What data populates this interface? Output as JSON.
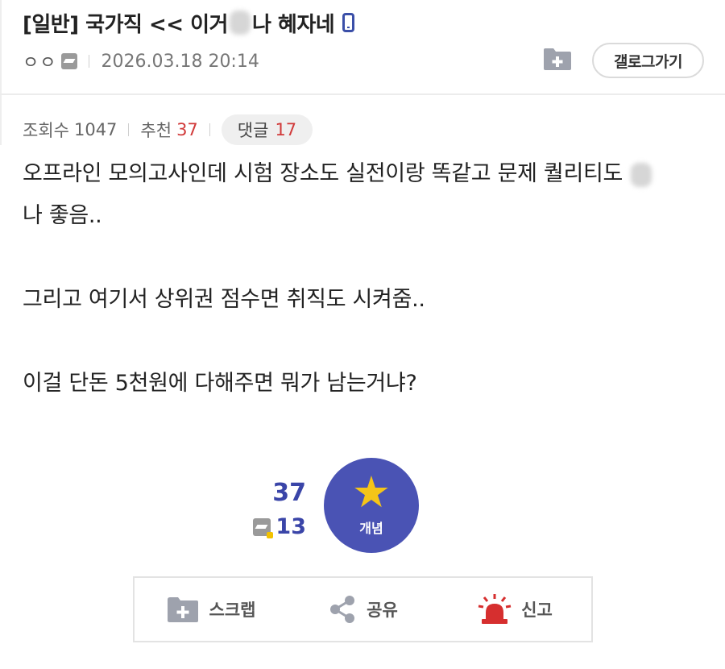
{
  "post": {
    "title_prefix": "[일반] 국가직 << 이거",
    "title_suffix": "나 혜자네",
    "author": "ㅇㅇ",
    "date": "2026.03.18 20:14",
    "gallery_button": "갤로그가기"
  },
  "stats": {
    "views_label": "조회수",
    "views": "1047",
    "recommend_label": "추천",
    "recommend": "37",
    "comments_label": "댓글",
    "comments": "17"
  },
  "content": {
    "line1": "오프라인 모의고사인데 시험 장소도 실전이랑 똑같고 문제 퀄리티도",
    "line2": "나 좋음..",
    "line3": "그리고 여기서 상위권 점수면 취직도 시켜줌..",
    "line4": "이걸 단돈 5천원에 다해주면 뭐가 남는거냐?"
  },
  "vote": {
    "count": "37",
    "fixed_count": "13",
    "button_label": "개념"
  },
  "actions": {
    "scrap": "스크랩",
    "share": "공유",
    "report": "신고"
  },
  "colors": {
    "accent": "#4a53b4",
    "count": "#3a45a8",
    "red": "#d13a3a",
    "star": "#f5c518",
    "report_icon": "#d62f2f"
  },
  "icons": {
    "mobile": "mobile-icon",
    "user": "fixed-nick-icon",
    "folder": "folder-plus-icon",
    "star": "star-icon",
    "share": "share-icon",
    "siren": "siren-icon"
  }
}
